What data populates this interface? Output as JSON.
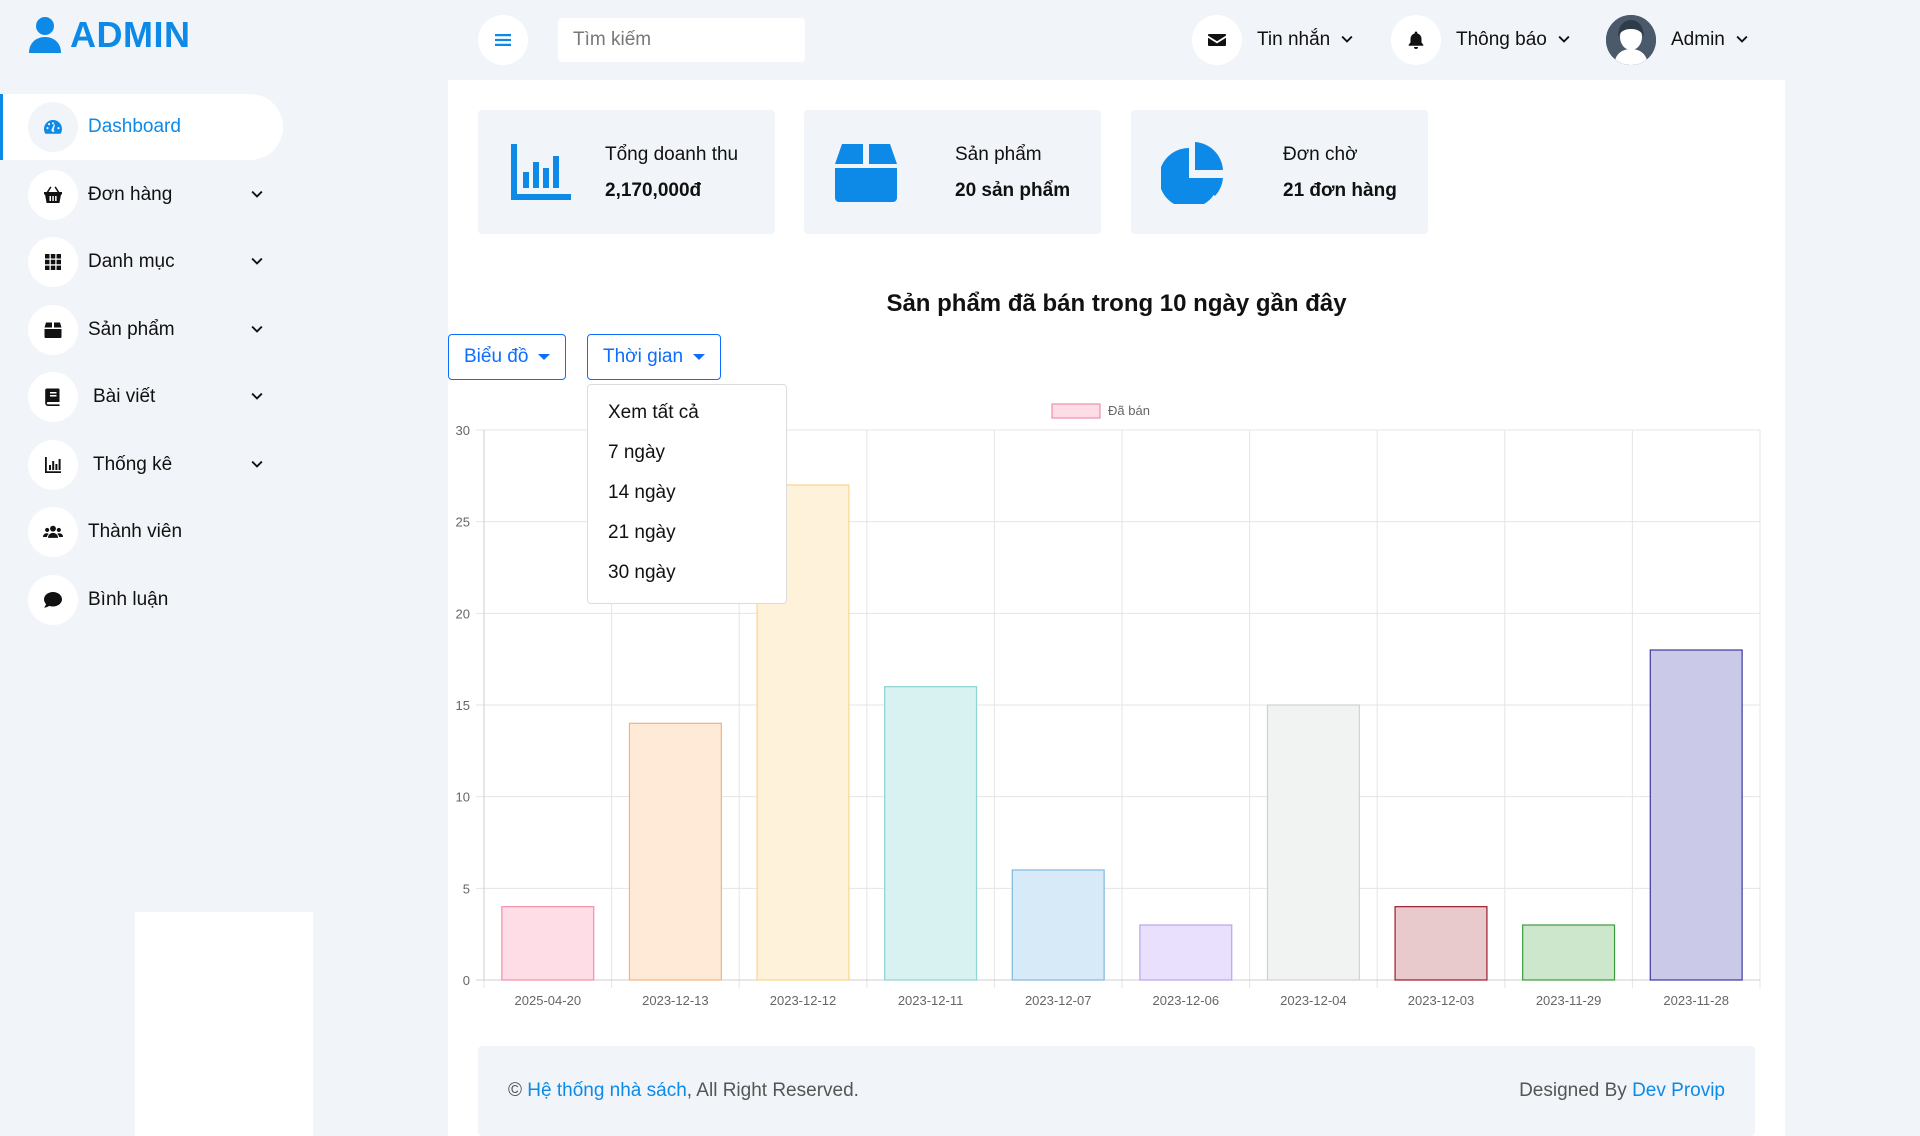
{
  "brand": {
    "name": "ADMIN"
  },
  "sidebar": {
    "items": [
      {
        "label": "Dashboard",
        "icon": "gauge-icon",
        "active": true
      },
      {
        "label": "Đơn hàng",
        "icon": "basket-icon",
        "dropdown": true
      },
      {
        "label": "Danh mục",
        "icon": "grid-icon",
        "dropdown": true
      },
      {
        "label": "Sản phẩm",
        "icon": "box-icon",
        "dropdown": true
      },
      {
        "label": "Bài viết",
        "icon": "book-icon",
        "dropdown": true
      },
      {
        "label": "Thống kê",
        "icon": "bar-chart-icon",
        "dropdown": true
      },
      {
        "label": "Thành viên",
        "icon": "users-icon"
      },
      {
        "label": "Bình luận",
        "icon": "comment-icon"
      }
    ]
  },
  "topbar": {
    "search_placeholder": "Tìm kiếm",
    "messages_label": "Tin nhắn",
    "notifications_label": "Thông báo",
    "user_label": "Admin"
  },
  "stats": [
    {
      "title": "Tổng doanh thu",
      "value": "2,170,000đ",
      "icon": "bar-chart-icon"
    },
    {
      "title": "Sản phẩm",
      "value": "20 sản phẩm",
      "icon": "box-icon"
    },
    {
      "title": "Đơn chờ",
      "value": "21 đơn hàng",
      "icon": "pie-chart-icon"
    }
  ],
  "controls": {
    "chart_button": "Biểu đồ",
    "time_button": "Thời gian",
    "time_options": [
      "Xem tất cả",
      "7 ngày",
      "14 ngày",
      "21 ngày",
      "30 ngày"
    ]
  },
  "chart_data": {
    "type": "bar",
    "title": "Sản phẩm đã bán trong 10 ngày gần đây",
    "categories": [
      "2025-04-20",
      "2023-12-13",
      "2023-12-12",
      "2023-12-11",
      "2023-12-07",
      "2023-12-06",
      "2023-12-04",
      "2023-12-03",
      "2023-11-29",
      "2023-11-28"
    ],
    "series": [
      {
        "name": "Đã bán",
        "values": [
          4,
          14,
          27,
          16,
          6,
          3,
          15,
          4,
          3,
          18
        ]
      }
    ],
    "ylim": [
      0,
      30
    ],
    "yticks": [
      0,
      5,
      10,
      15,
      20,
      25,
      30
    ],
    "legend": "top-center",
    "grid": true,
    "fill_colors": [
      "#ffdde6",
      "#ffead7",
      "#fff2db",
      "#d8f1f1",
      "#d6eaf8",
      "#e8e0fc",
      "#f1f2f2",
      "#e8c9cc",
      "#cde7cd",
      "#cacae8"
    ],
    "border_colors": [
      "#f08fa8",
      "#f6b27a",
      "#f9d68a",
      "#8fd3d3",
      "#7fb8e0",
      "#b9a3f0",
      "#cfd1d3",
      "#9b1c2c",
      "#3c9a3c",
      "#3a3aa0"
    ]
  },
  "footer": {
    "copyright_prefix": "© ",
    "copyright_link": "Hệ thống nhà sách",
    "copyright_suffix": ", All Right Reserved.",
    "designed_prefix": "Designed By ",
    "designed_link": "Dev Provip"
  }
}
